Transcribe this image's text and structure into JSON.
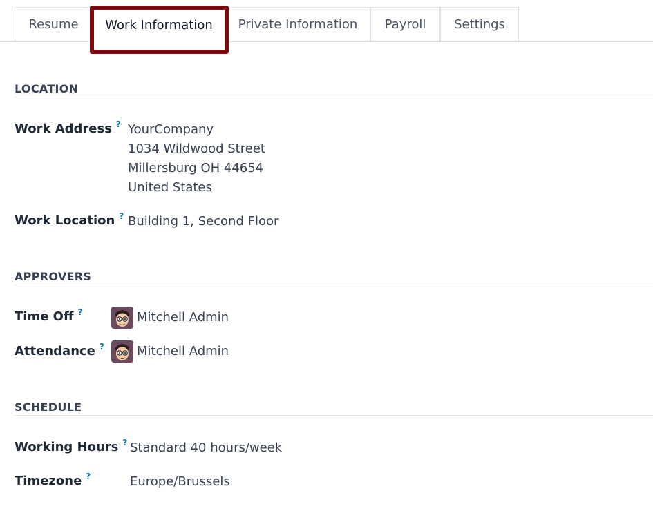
{
  "tabs": [
    {
      "label": "Resume"
    },
    {
      "label": "Work Information"
    },
    {
      "label": "Private Information"
    },
    {
      "label": "Payroll"
    },
    {
      "label": "Settings"
    }
  ],
  "help_mark": "?",
  "location": {
    "title": "LOCATION",
    "work_address": {
      "label": "Work Address",
      "lines": [
        "YourCompany",
        "1034 Wildwood Street",
        "Millersburg OH 44654",
        "United States"
      ]
    },
    "work_location": {
      "label": "Work Location",
      "value": "Building 1, Second Floor"
    }
  },
  "approvers": {
    "title": "APPROVERS",
    "time_off": {
      "label": "Time Off",
      "value": "Mitchell Admin"
    },
    "attendance": {
      "label": "Attendance",
      "value": "Mitchell Admin"
    }
  },
  "schedule": {
    "title": "SCHEDULE",
    "working_hours": {
      "label": "Working Hours",
      "value": "Standard 40 hours/week"
    },
    "timezone": {
      "label": "Timezone",
      "value": "Europe/Brussels"
    }
  },
  "colors": {
    "highlight": "#7b0c12",
    "help": "#0d7a9a"
  },
  "icons": {
    "avatar": "user-avatar-icon"
  }
}
